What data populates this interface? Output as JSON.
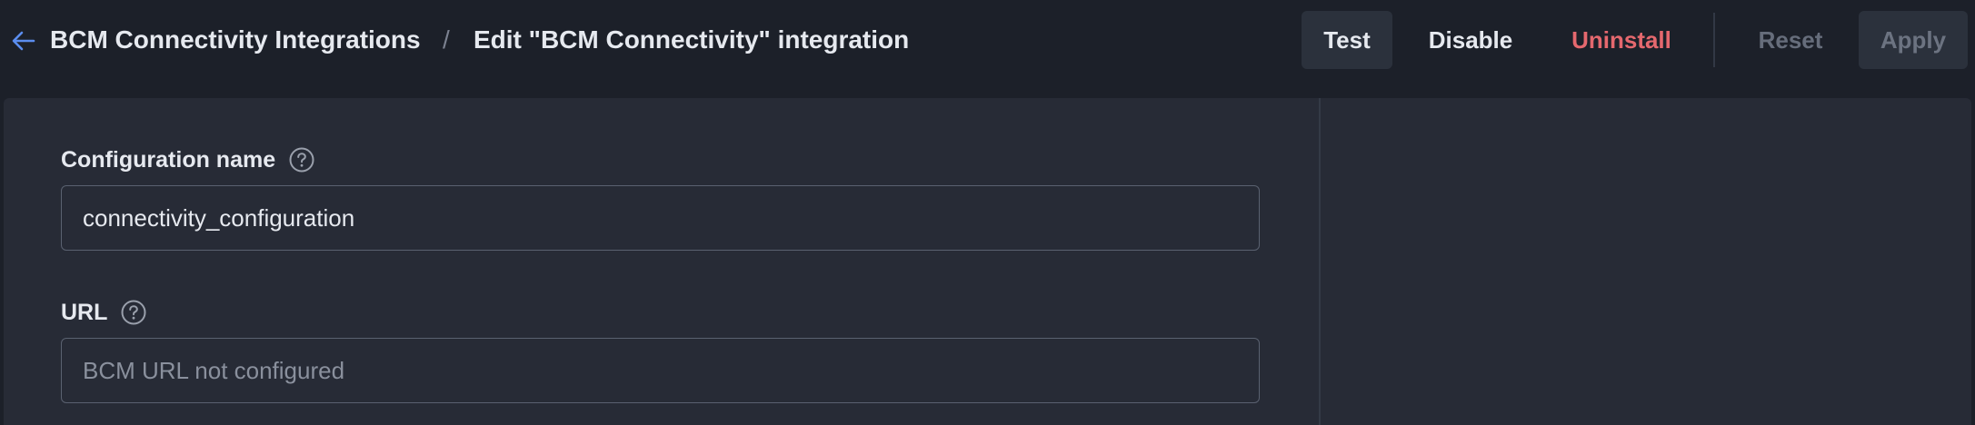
{
  "header": {
    "back_icon": "arrow-left-icon",
    "breadcrumb_parent": "BCM Connectivity Integrations",
    "breadcrumb_separator": "/",
    "breadcrumb_current": "Edit \"BCM Connectivity\" integration"
  },
  "actions": {
    "test_label": "Test",
    "disable_label": "Disable",
    "uninstall_label": "Uninstall",
    "reset_label": "Reset",
    "apply_label": "Apply"
  },
  "form": {
    "config_name": {
      "label": "Configuration name",
      "help_icon": "question-circle-icon",
      "value": "connectivity_configuration",
      "placeholder": ""
    },
    "url": {
      "label": "URL",
      "help_icon": "question-circle-icon",
      "value": "",
      "placeholder": "BCM URL not configured"
    }
  },
  "colors": {
    "background": "#1c2029",
    "panel": "#272b36",
    "accent_blue": "#5b8def",
    "danger": "#e5686e",
    "button_bg": "#2b313c",
    "disabled_text": "#666d7b"
  }
}
